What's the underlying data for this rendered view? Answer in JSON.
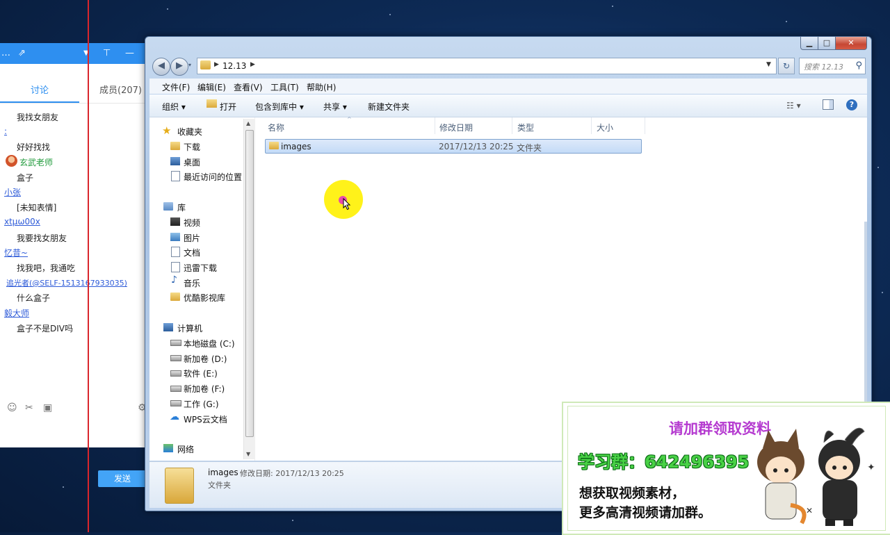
{
  "chat": {
    "header_title": "…",
    "tabs": {
      "discuss": "讨论",
      "members": "成员(207)"
    },
    "messages": [
      {
        "user": "",
        "text": "我找女朋友"
      },
      {
        "user": "",
        "text": "好好找找"
      },
      {
        "user": "玄武老师",
        "text": "盒子"
      },
      {
        "user": "小张",
        "text": "[未知表情]"
      },
      {
        "user": "xtµω00x",
        "text": "我要找女朋友"
      },
      {
        "user": "忆昔~",
        "text": "找我吧，我通吃"
      },
      {
        "user": "追光者(@SELF-1513167933035)",
        "text": "什么盒子"
      },
      {
        "user": "毅大师",
        "text": "盒子不是DIV吗"
      }
    ],
    "send_label": "发送"
  },
  "explorer": {
    "address": "12.13",
    "search_placeholder": "搜索 12.13",
    "menu": [
      "文件(F)",
      "编辑(E)",
      "查看(V)",
      "工具(T)",
      "帮助(H)"
    ],
    "toolbar": {
      "organize": "组织 ▾",
      "open": "打开",
      "include": "包含到库中 ▾",
      "share": "共享 ▾",
      "new_folder": "新建文件夹"
    },
    "nav": {
      "favorites": "收藏夹",
      "fav_items": [
        "下载",
        "桌面",
        "最近访问的位置"
      ],
      "libraries": "库",
      "lib_items": [
        "视频",
        "图片",
        "文档",
        "迅雷下载",
        "音乐",
        "优酷影视库"
      ],
      "computer": "计算机",
      "drives": [
        "本地磁盘 (C:)",
        "新加卷 (D:)",
        "软件 (E:)",
        "新加卷 (F:)",
        "工作 (G:)",
        "WPS云文档"
      ],
      "network": "网络"
    },
    "columns": {
      "name": "名称",
      "date": "修改日期",
      "type": "类型",
      "size": "大小"
    },
    "files": [
      {
        "name": "images",
        "date": "2017/12/13 20:25",
        "type": "文件夹"
      }
    ],
    "details": {
      "name": "images",
      "date_label": "修改日期: 2017/12/13 20:25",
      "type": "文件夹"
    }
  },
  "promo": {
    "title": "请加群领取资料",
    "group": "学习群：642496395",
    "line1": "想获取视频素材，",
    "line2": "更多高清视频请加群。"
  }
}
